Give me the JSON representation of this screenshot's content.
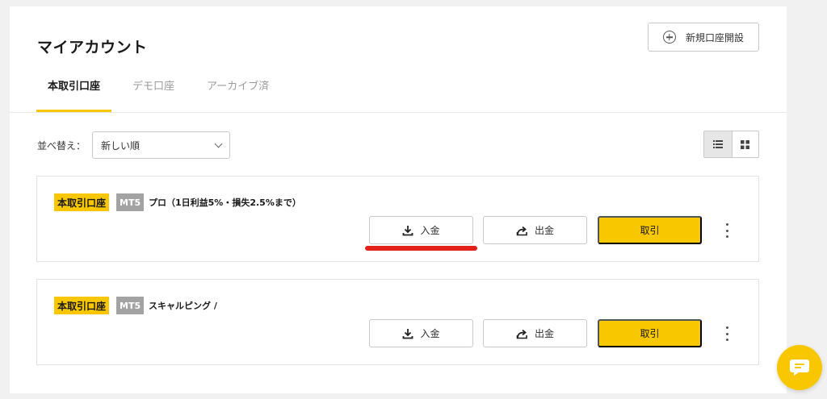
{
  "page": {
    "title": "マイアカウント",
    "new_account_label": "新規口座開設"
  },
  "tabs": [
    {
      "label": "本取引口座",
      "active": true
    },
    {
      "label": "デモ口座",
      "active": false
    },
    {
      "label": "アーカイブ済",
      "active": false
    }
  ],
  "sort": {
    "label": "並べ替え：",
    "selected": "新しい順"
  },
  "view_modes": [
    "list",
    "grid"
  ],
  "accounts": [
    {
      "type_badge": "本取引口座",
      "platform_badge": "MT5",
      "name": "プロ（1日利益5%・損失2.5%まで）",
      "deposit_label": "入金",
      "withdraw_label": "出金",
      "trade_label": "取引"
    },
    {
      "type_badge": "本取引口座",
      "platform_badge": "MT5",
      "name": "スキャルピング /",
      "deposit_label": "入金",
      "withdraw_label": "出金",
      "trade_label": "取引"
    }
  ],
  "colors": {
    "accent": "#f8c700",
    "mt5_badge": "#a3a3a3",
    "highlight": "#e3211b"
  }
}
